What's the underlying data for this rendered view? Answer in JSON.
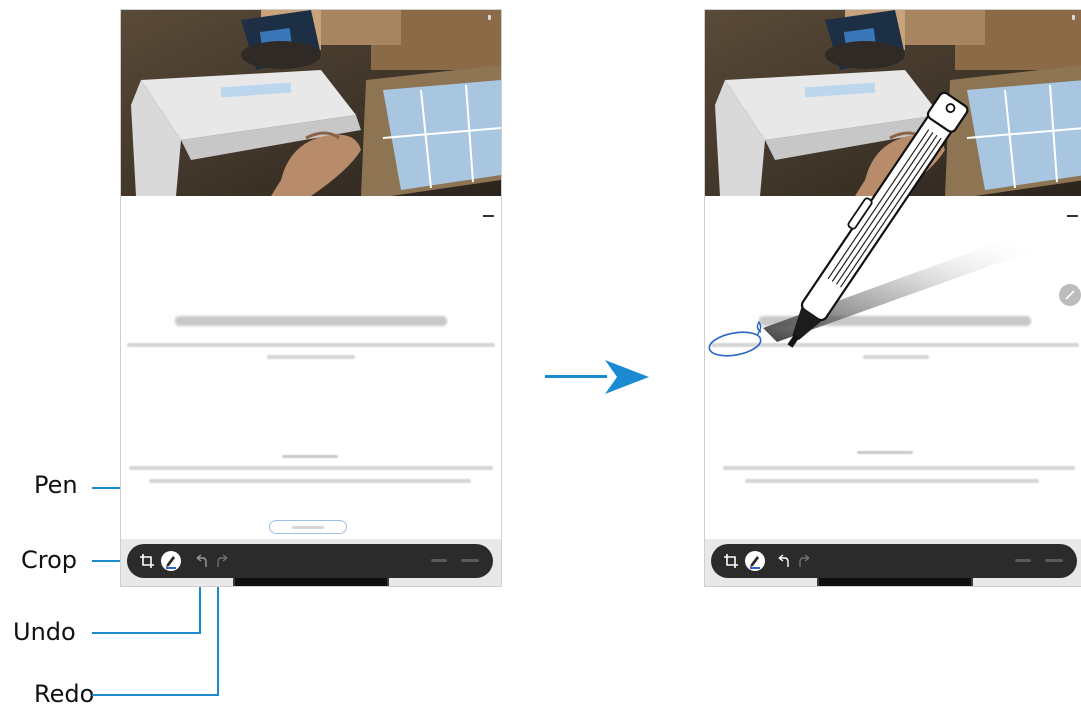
{
  "callouts": {
    "pen": "Pen",
    "crop": "Crop",
    "undo": "Undo",
    "redo": "Redo"
  },
  "colors": {
    "callout_line": "#1b8bd1",
    "toolbar": "#2b2b2b",
    "arrow": "#1b8bd1",
    "pen_stroke": "#2a64c8"
  },
  "icons": {
    "crop": "crop-icon",
    "pen": "pen-icon",
    "undo": "undo-icon",
    "redo": "redo-icon",
    "transition": "right-arrow-icon",
    "stylus": "s-pen-stylus"
  }
}
